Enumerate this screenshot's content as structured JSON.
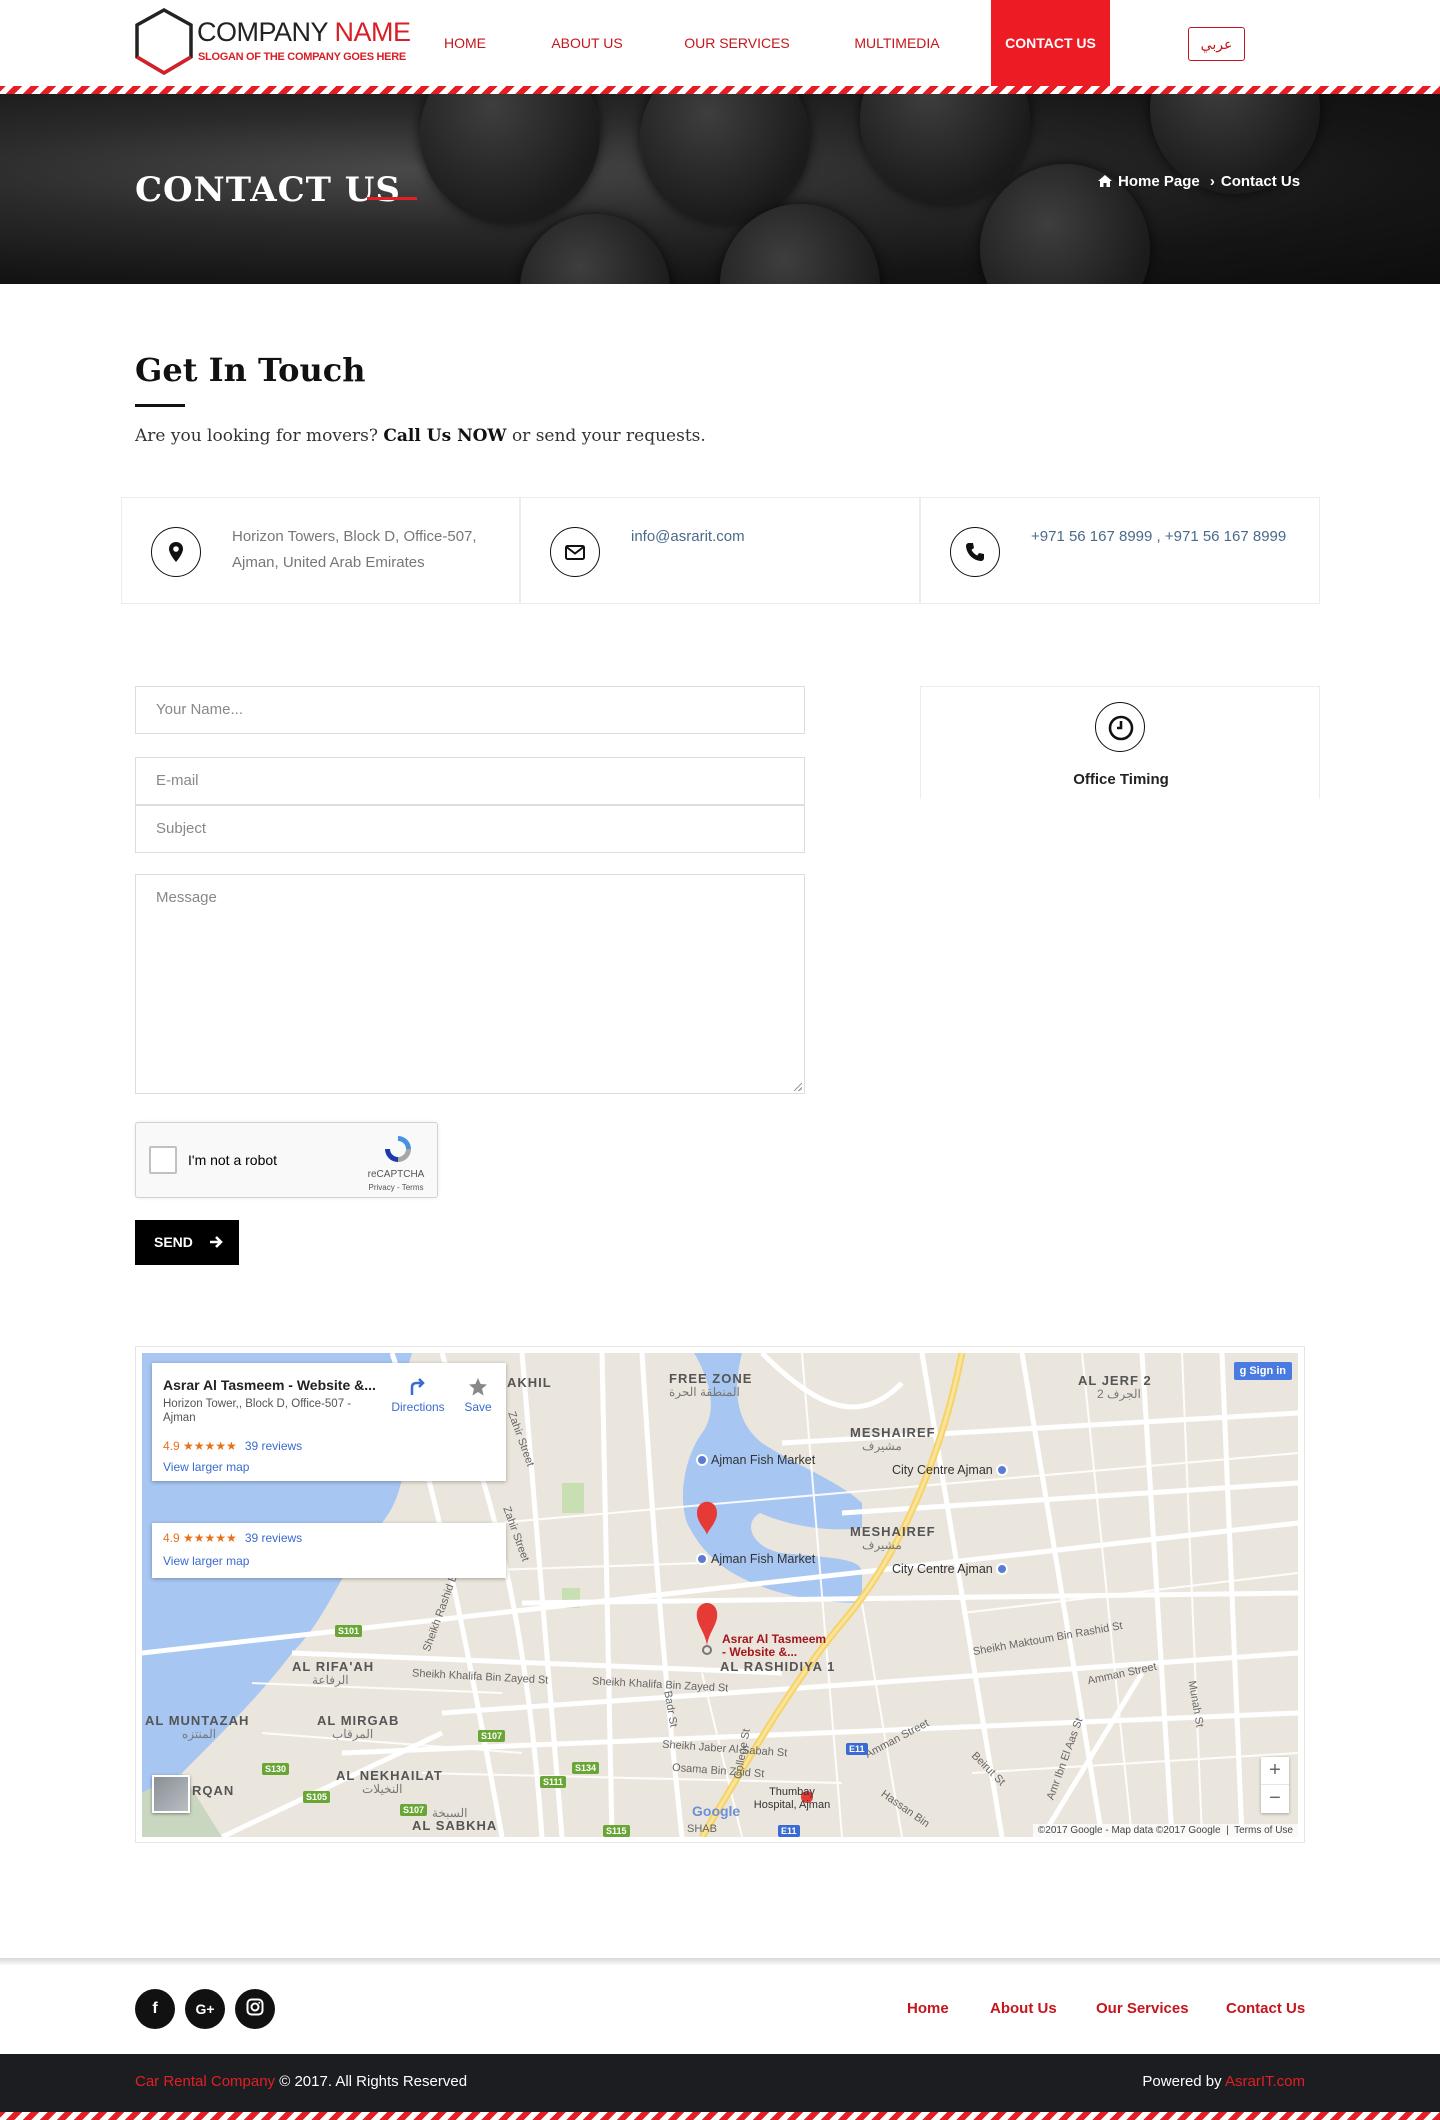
{
  "header": {
    "logo_name_1": "COMPANY",
    "logo_name_2": "NAME",
    "logo_slogan": "SLOGAN OF THE COMPANY GOES HERE",
    "nav": [
      "HOME",
      "ABOUT US",
      "OUR SERVICES",
      "MULTIMEDIA",
      "CONTACT US"
    ],
    "lang": "عربي",
    "accent": "#ed1c24"
  },
  "banner": {
    "title": "CONTACT US",
    "breadcrumb_home": "Home Page",
    "breadcrumb_current": "Contact Us"
  },
  "section": {
    "title": "Get In Touch",
    "intro_a": "Are you looking for movers?",
    "intro_b": "Call Us NOW",
    "intro_c": "or send your requests."
  },
  "contact": {
    "address_1": "Horizon Towers, Block D, Office-507,",
    "address_2": "Ajman, United Arab Emirates",
    "email": "info@asrarit.com",
    "phone": "+971 56 167 8999 , +971 56 167 8999"
  },
  "form": {
    "name_placeholder": "Your Name...",
    "email_placeholder": "E-mail",
    "subject_placeholder": "Subject",
    "message_placeholder": "Message",
    "captcha_label": "I'm not a robot",
    "captcha_brand": "reCAPTCHA",
    "captcha_links": "Privacy - Terms",
    "send": "SEND"
  },
  "timing": {
    "label": "Office Timing"
  },
  "map": {
    "card_title": "Asrar Al Tasmeem - Website &...",
    "card_address": "Horizon Tower,, Block D, Office-507 - Ajman",
    "rating": "4.9 ★★★★★",
    "reviews": "39 reviews",
    "larger_map": "View larger map",
    "directions": "Directions",
    "save": "Save",
    "sign_in": "Sign in",
    "marker_label_1": "Asrar Al Tasmeem",
    "marker_label_2": "- Website &...",
    "attribution": "©2017 Google - Map data ©2017 Google",
    "terms": "Terms of Use",
    "google": "Google",
    "areas": [
      "FREE ZONE",
      "AL JERF 2",
      "MESHAIREF",
      "MESHAIREF",
      "AL RASHIDIYA 1",
      "AL RIFA'AH",
      "AL MIRGAB",
      "AL MUNTAZAH",
      "AL NEKHAILAT",
      "AL SABKHA",
      "RQAN",
      "AKHIL",
      "SHAB",
      "Thumbay Hospital, Ajman"
    ],
    "areas_ar": [
      "المنطقة الحرة",
      "الجرف 2",
      "مشيرف",
      "مشيرف",
      "الرفاعة",
      "المرقاب",
      "المنتزه",
      "النخيلات",
      "السبخة"
    ],
    "pois": [
      "Ajman Fish Market",
      "City Centre Ajman",
      "Ajman Fish Market",
      "City Centre Ajman"
    ],
    "roads": [
      "Sheikh Khalifa Bin Zayed St",
      "Sheikh Khalifa Bin Zayed St",
      "Sheikh Maktoum Bin Rashid St",
      "Sheikh Jaber Al-Sabah St",
      "Osama Bin Zaid St",
      "Amman Street",
      "Amman Street",
      "Hassan Bin",
      "Beirut St",
      "Amr Ibn El Aas St",
      "Munah St",
      "Zahir Street",
      "Zahir Street",
      "Sheikh Rashid Bin",
      "Badr St",
      "College St"
    ],
    "shields": [
      "S101",
      "S107",
      "S130",
      "S105",
      "S107",
      "S111",
      "S134",
      "S115",
      "E11",
      "E11"
    ]
  },
  "footer": {
    "social": [
      "f",
      "G+",
      "ig"
    ],
    "links": [
      "Home",
      "About Us",
      "Our Services",
      "Contact Us"
    ],
    "copy_red": "Car Rental Company",
    "copy_rest": "© 2017. All Rights Reserved",
    "powered": "Powered by",
    "powered_red": "AsrarIT.com"
  }
}
